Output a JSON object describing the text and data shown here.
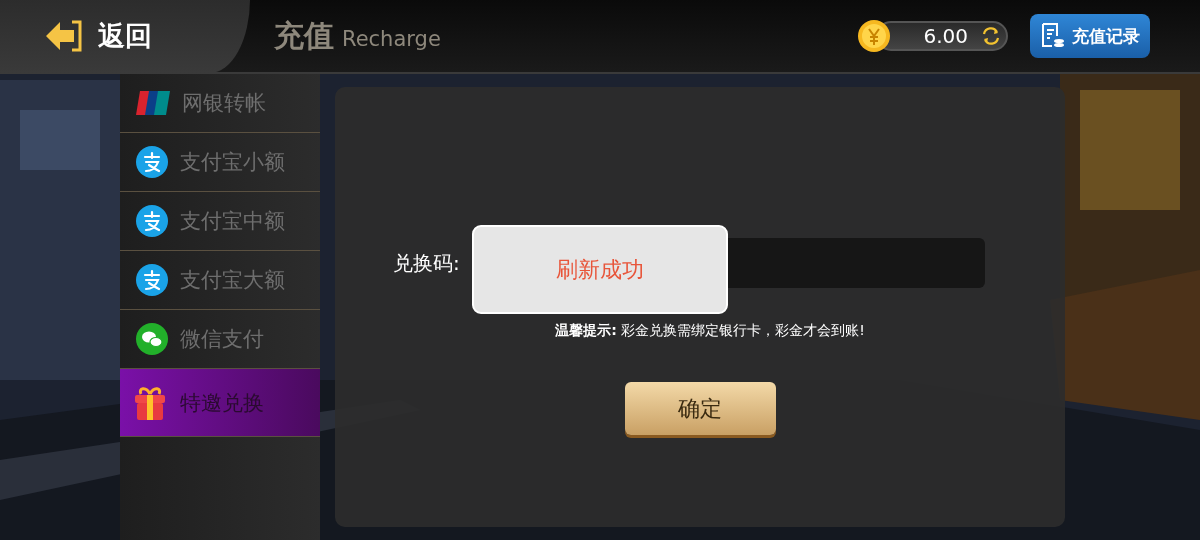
{
  "header": {
    "back_label": "返回",
    "title": "充值",
    "subtitle": "Recharge",
    "balance": "6.00",
    "records_button": "充值记录"
  },
  "sidebar": {
    "items": [
      {
        "label": "网银转帐",
        "kind": "unionpay",
        "selected": false
      },
      {
        "label": "支付宝小额",
        "kind": "alipay",
        "selected": false
      },
      {
        "label": "支付宝中额",
        "kind": "alipay",
        "selected": false
      },
      {
        "label": "支付宝大额",
        "kind": "alipay",
        "selected": false
      },
      {
        "label": "微信支付",
        "kind": "wechat",
        "selected": false
      },
      {
        "label": "特邀兑换",
        "kind": "gift",
        "selected": true
      }
    ]
  },
  "form": {
    "label": "兑换码:",
    "tip": "**温馨提示:** 彩金兑换需绑定银行卡，彩金才会到账!",
    "confirm_button": "确定"
  },
  "toast": {
    "message": "刷新成功"
  }
}
